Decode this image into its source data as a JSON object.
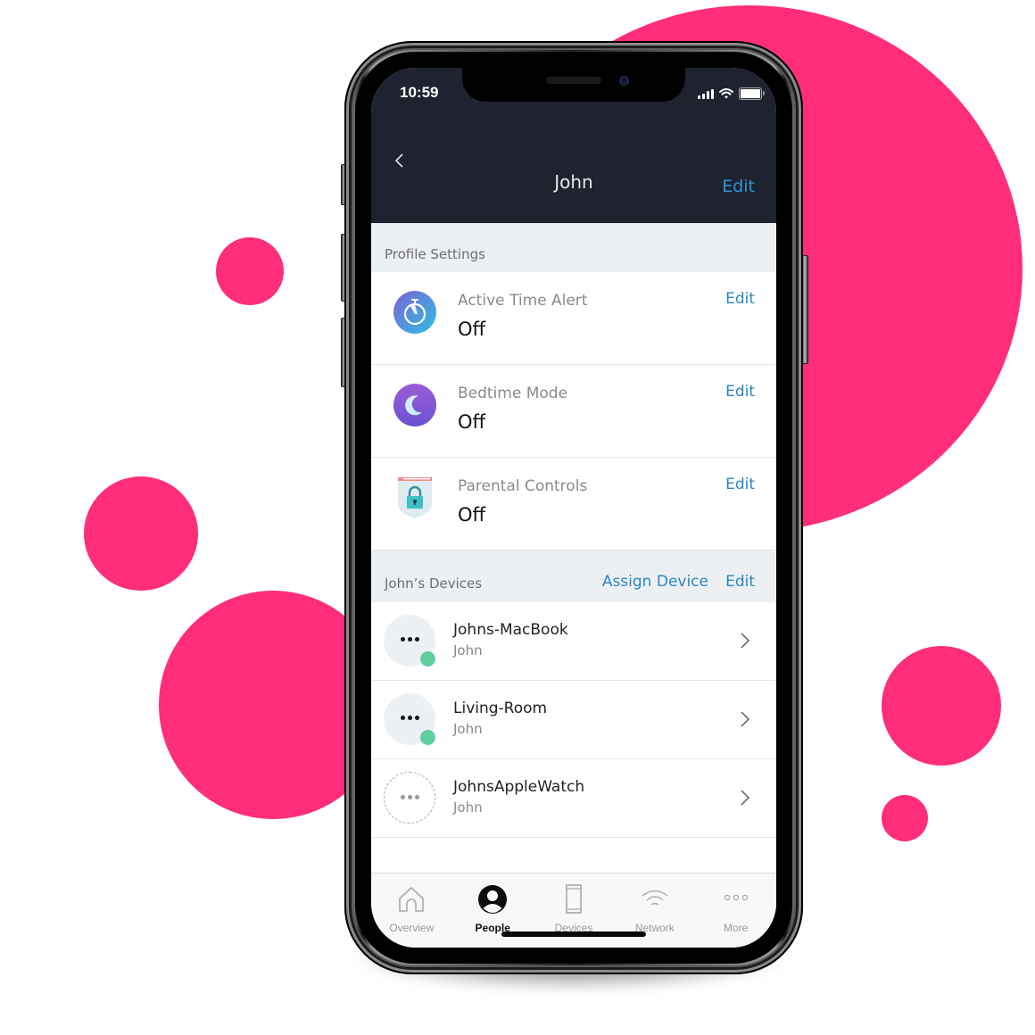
{
  "theme": {
    "accent": "#2a86c2",
    "background_blobs": "#ff2d7a",
    "header_bg": "#1f2330",
    "online_status": "#5fcfa0"
  },
  "status_bar": {
    "time": "10:59",
    "icons": [
      "cellular-signal-icon",
      "wifi-icon",
      "battery-icon"
    ]
  },
  "nav": {
    "back_icon": "chevron-left-icon",
    "title": "John",
    "edit_label": "Edit"
  },
  "profile_settings": {
    "header": "Profile Settings",
    "items": [
      {
        "name": "Active Time Alert",
        "value": "Off",
        "edit_label": "Edit",
        "icon": "stopwatch-icon"
      },
      {
        "name": "Bedtime Mode",
        "value": "Off",
        "edit_label": "Edit",
        "icon": "moon-icon"
      },
      {
        "name": "Parental Controls",
        "value": "Off",
        "edit_label": "Edit",
        "icon": "lock-shield-icon"
      }
    ]
  },
  "devices": {
    "header": "John’s Devices",
    "assign_label": "Assign Device",
    "edit_label": "Edit",
    "items": [
      {
        "name": "Johns-MacBook",
        "owner": "John",
        "online": true
      },
      {
        "name": "Living-Room",
        "owner": "John",
        "online": true
      },
      {
        "name": "JohnsAppleWatch",
        "owner": "John",
        "online": false
      }
    ]
  },
  "tabbar": {
    "active": "People",
    "tabs": [
      {
        "label": "Overview",
        "icon": "home-icon"
      },
      {
        "label": "People",
        "icon": "person-icon"
      },
      {
        "label": "Devices",
        "icon": "phone-device-icon"
      },
      {
        "label": "Network",
        "icon": "wifi-icon"
      },
      {
        "label": "More",
        "icon": "more-dots-icon"
      }
    ]
  }
}
